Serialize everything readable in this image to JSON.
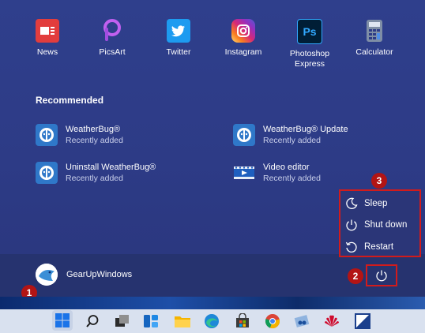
{
  "pinned_apps": [
    {
      "label": "News",
      "icon": "news-icon",
      "color": "#e23d3d"
    },
    {
      "label": "PicsArt",
      "icon": "picsart-icon",
      "color": "#b052e8"
    },
    {
      "label": "Twitter",
      "icon": "twitter-icon",
      "color": "#1d9bf0"
    },
    {
      "label": "Instagram",
      "icon": "instagram-icon",
      "color": "#d62976"
    },
    {
      "label": "Photoshop Express",
      "icon": "photoshop-express-icon",
      "color": "#001e36",
      "glyph": "Ps"
    },
    {
      "label": "Calculator",
      "icon": "calculator-icon",
      "color": "#9aa6b8"
    }
  ],
  "recommended": {
    "title": "Recommended",
    "items": [
      {
        "title": "WeatherBug®",
        "subtitle": "Recently added",
        "icon": "weatherbug-icon"
      },
      {
        "title": "WeatherBug® Update",
        "subtitle": "Recently added",
        "icon": "weatherbug-icon"
      },
      {
        "title": "Uninstall WeatherBug®",
        "subtitle": "Recently added",
        "icon": "weatherbug-icon"
      },
      {
        "title": "Video editor",
        "subtitle": "Recently added",
        "icon": "video-editor-icon"
      }
    ]
  },
  "user": {
    "name": "GearUpWindows"
  },
  "power_menu": {
    "items": [
      {
        "label": "Sleep",
        "icon": "moon-icon"
      },
      {
        "label": "Shut down",
        "icon": "power-icon"
      },
      {
        "label": "Restart",
        "icon": "restart-icon"
      }
    ]
  },
  "annotations": {
    "step1": "1",
    "step2": "2",
    "step3": "3"
  },
  "taskbar": {
    "icons": [
      "start-icon",
      "search-icon",
      "task-view-icon",
      "widgets-icon",
      "file-explorer-icon",
      "edge-icon",
      "store-icon",
      "chrome-icon",
      "snipping-tool-icon",
      "huawei-icon",
      "app-icon"
    ]
  },
  "colors": {
    "highlight": "#d21b1b",
    "badge": "#b31414",
    "accent": "#2f3f8c"
  }
}
